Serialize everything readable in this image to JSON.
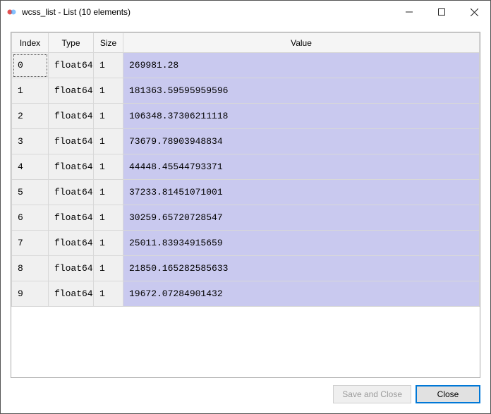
{
  "window": {
    "title": "wcss_list - List (10 elements)"
  },
  "columns": {
    "index": "Index",
    "type": "Type",
    "size": "Size",
    "value": "Value"
  },
  "rows": [
    {
      "index": "0",
      "type": "float64",
      "size": "1",
      "value": "269981.28"
    },
    {
      "index": "1",
      "type": "float64",
      "size": "1",
      "value": "181363.59595959596"
    },
    {
      "index": "2",
      "type": "float64",
      "size": "1",
      "value": "106348.37306211118"
    },
    {
      "index": "3",
      "type": "float64",
      "size": "1",
      "value": "73679.78903948834"
    },
    {
      "index": "4",
      "type": "float64",
      "size": "1",
      "value": "44448.45544793371"
    },
    {
      "index": "5",
      "type": "float64",
      "size": "1",
      "value": "37233.81451071001"
    },
    {
      "index": "6",
      "type": "float64",
      "size": "1",
      "value": "30259.65720728547"
    },
    {
      "index": "7",
      "type": "float64",
      "size": "1",
      "value": "25011.83934915659"
    },
    {
      "index": "8",
      "type": "float64",
      "size": "1",
      "value": "21850.165282585633"
    },
    {
      "index": "9",
      "type": "float64",
      "size": "1",
      "value": "19672.07284901432"
    }
  ],
  "buttons": {
    "save_and_close": "Save and Close",
    "close": "Close"
  }
}
